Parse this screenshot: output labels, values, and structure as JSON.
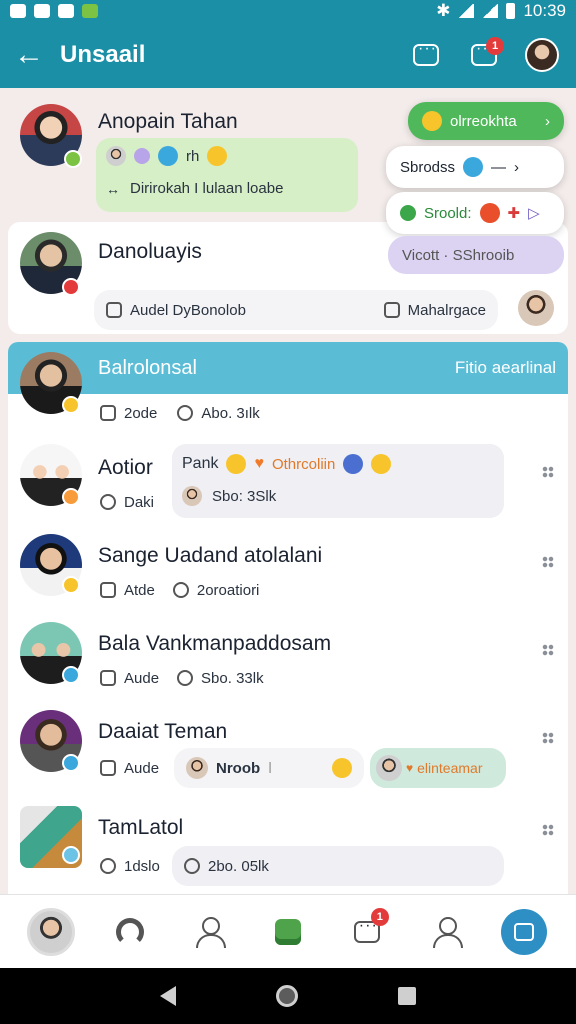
{
  "status": {
    "time": "10:39"
  },
  "appbar": {
    "title": "Unsaail",
    "notif_count": "1"
  },
  "top_chat": {
    "name": "Anopain Tahan",
    "emoji_text": "rh",
    "message": "Dirirokah I lulaan loabe"
  },
  "popups": {
    "green_pill": "olrreokhta",
    "menu_1": "Sbrodss",
    "menu_2": "Sroold:",
    "menu_3": "Vicott · SShrooib"
  },
  "card2": {
    "name": "Danoluayis",
    "chip_left": "Audel DyBonolob",
    "chip_right": "Mahalrgace"
  },
  "panel": {
    "header_left": "Balrolonsal",
    "header_right": "Fitio aearlinal"
  },
  "rows": [
    {
      "name": "",
      "meta_left": "2ode",
      "meta_right": "Abo. 3ılk"
    },
    {
      "name": "Aotior",
      "meta_left": "Daki",
      "bubble_top_left": "Pank",
      "bubble_top_right": "Othrcoliin",
      "bubble_bottom": "Sbo: 3Slk"
    },
    {
      "name": "Sange Uadand atolalani",
      "meta_left": "Atde",
      "meta_right": "2oroatiori"
    },
    {
      "name": "Bala Vankmanpaddosam",
      "meta_left": "Aude",
      "meta_right": "Sbo. 33lk"
    },
    {
      "name": "Daaiat Teman",
      "meta_left": "Aude",
      "chip_mid": "Nroob",
      "chip_right": "elinteamar"
    },
    {
      "name": "TamLatol",
      "meta_left": "1dslo",
      "bubble": "2bo. 05lk"
    }
  ],
  "nav": {
    "chat_badge": "1"
  },
  "colors": {
    "brand": "#1b8fa6",
    "header_panel": "#5bbcd6",
    "accent_green": "#4fb85a",
    "fab": "#2e8fc4"
  }
}
